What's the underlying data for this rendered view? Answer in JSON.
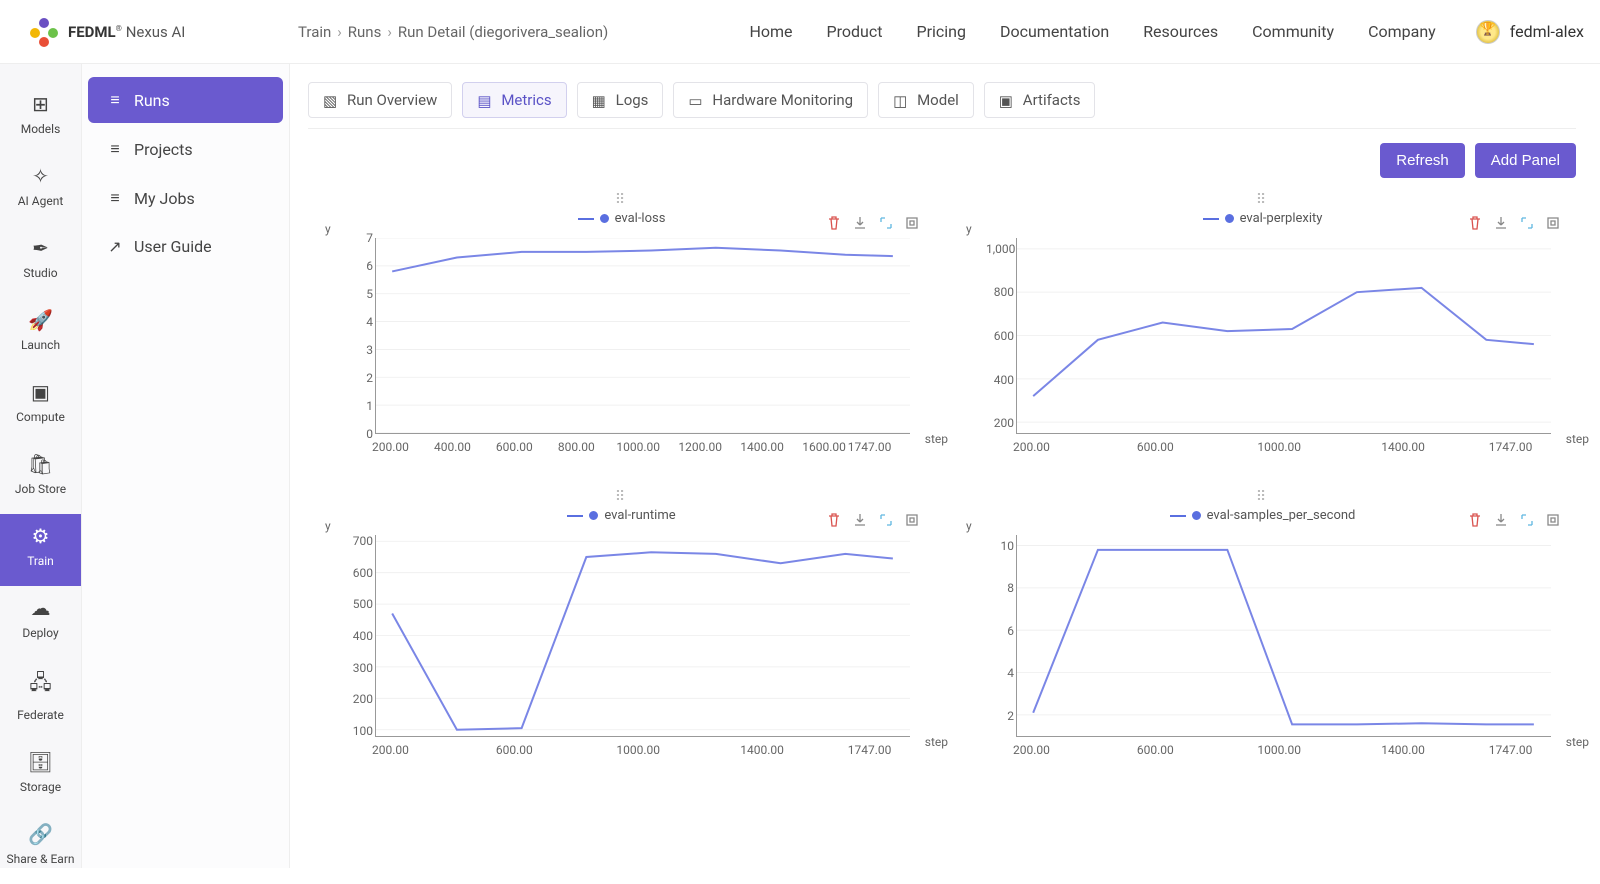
{
  "brand": {
    "name": "FEDML",
    "reg": "®",
    "suffix": " Nexus AI"
  },
  "breadcrumb": [
    "Train",
    "Runs",
    "Run Detail (diegorivera_sealion)"
  ],
  "topnav": [
    "Home",
    "Product",
    "Pricing",
    "Documentation",
    "Resources",
    "Community",
    "Company"
  ],
  "user": {
    "name": "fedml-alex"
  },
  "rail": [
    {
      "label": "Models",
      "icon": "⊞"
    },
    {
      "label": "AI Agent",
      "icon": "✧"
    },
    {
      "label": "Studio",
      "icon": "✒"
    },
    {
      "label": "Launch",
      "icon": "🚀"
    },
    {
      "label": "Compute",
      "icon": "▣"
    },
    {
      "label": "Job Store",
      "icon": "🛍"
    },
    {
      "label": "Train",
      "icon": "⚙",
      "active": true
    },
    {
      "label": "Deploy",
      "icon": "☁"
    },
    {
      "label": "Federate",
      "icon": "🖧"
    },
    {
      "label": "Storage",
      "icon": "🗄"
    },
    {
      "label": "Share & Earn",
      "icon": "🔗"
    }
  ],
  "sidebar": [
    {
      "label": "Runs",
      "icon": "≡",
      "active": true
    },
    {
      "label": "Projects",
      "icon": "≡"
    },
    {
      "label": "My Jobs",
      "icon": "≡"
    },
    {
      "label": "User Guide",
      "icon": "↗"
    }
  ],
  "tabs": [
    {
      "label": "Run Overview",
      "icon": "▧"
    },
    {
      "label": "Metrics",
      "icon": "▤",
      "active": true
    },
    {
      "label": "Logs",
      "icon": "▦"
    },
    {
      "label": "Hardware Monitoring",
      "icon": "▭"
    },
    {
      "label": "Model",
      "icon": "◫"
    },
    {
      "label": "Artifacts",
      "icon": "▣"
    }
  ],
  "actions": {
    "refresh": "Refresh",
    "addPanel": "Add Panel"
  },
  "chart_data": [
    {
      "type": "line",
      "title": "eval-loss",
      "xlabel": "step",
      "ylabel": "y",
      "x": [
        200,
        400,
        600,
        800,
        1000,
        1200,
        1400,
        1600,
        1747
      ],
      "values": [
        5.8,
        6.3,
        6.5,
        6.5,
        6.55,
        6.65,
        6.55,
        6.4,
        6.35
      ],
      "xticks": [
        "200.00",
        "400.00",
        "600.00",
        "800.00",
        "1000.00",
        "1200.00",
        "1400.00",
        "1600.00",
        "1747.00"
      ],
      "yticks": [
        0,
        1,
        2,
        3,
        4,
        5,
        6,
        7
      ],
      "ylim": [
        0,
        7
      ],
      "xlim": [
        150,
        1800
      ]
    },
    {
      "type": "line",
      "title": "eval-perplexity",
      "xlabel": "step",
      "ylabel": "y",
      "x": [
        200,
        400,
        600,
        800,
        1000,
        1200,
        1400,
        1600,
        1747
      ],
      "values": [
        320,
        580,
        660,
        620,
        630,
        800,
        820,
        580,
        560
      ],
      "xticks": [
        "200.00",
        "600.00",
        "1000.00",
        "1400.00",
        "1747.00"
      ],
      "yticks": [
        200,
        400,
        600,
        800,
        1000
      ],
      "ylim": [
        150,
        1050
      ],
      "xlim": [
        150,
        1800
      ]
    },
    {
      "type": "line",
      "title": "eval-runtime",
      "xlabel": "step",
      "ylabel": "y",
      "x": [
        200,
        400,
        600,
        800,
        1000,
        1200,
        1400,
        1600,
        1747
      ],
      "values": [
        470,
        100,
        105,
        650,
        665,
        660,
        630,
        660,
        645
      ],
      "xticks": [
        "200.00",
        "600.00",
        "1000.00",
        "1400.00",
        "1747.00"
      ],
      "yticks": [
        100,
        200,
        300,
        400,
        500,
        600,
        700
      ],
      "ylim": [
        80,
        720
      ],
      "xlim": [
        150,
        1800
      ]
    },
    {
      "type": "line",
      "title": "eval-samples_per_second",
      "xlabel": "step",
      "ylabel": "y",
      "x": [
        200,
        400,
        600,
        800,
        1000,
        1200,
        1400,
        1600,
        1747
      ],
      "values": [
        2.1,
        9.8,
        9.8,
        9.8,
        1.55,
        1.55,
        1.6,
        1.55,
        1.55
      ],
      "xticks": [
        "200.00",
        "600.00",
        "1000.00",
        "1400.00",
        "1747.00"
      ],
      "yticks": [
        2,
        4,
        6,
        8,
        10
      ],
      "ylim": [
        1,
        10.5
      ],
      "xlim": [
        150,
        1800
      ]
    }
  ]
}
